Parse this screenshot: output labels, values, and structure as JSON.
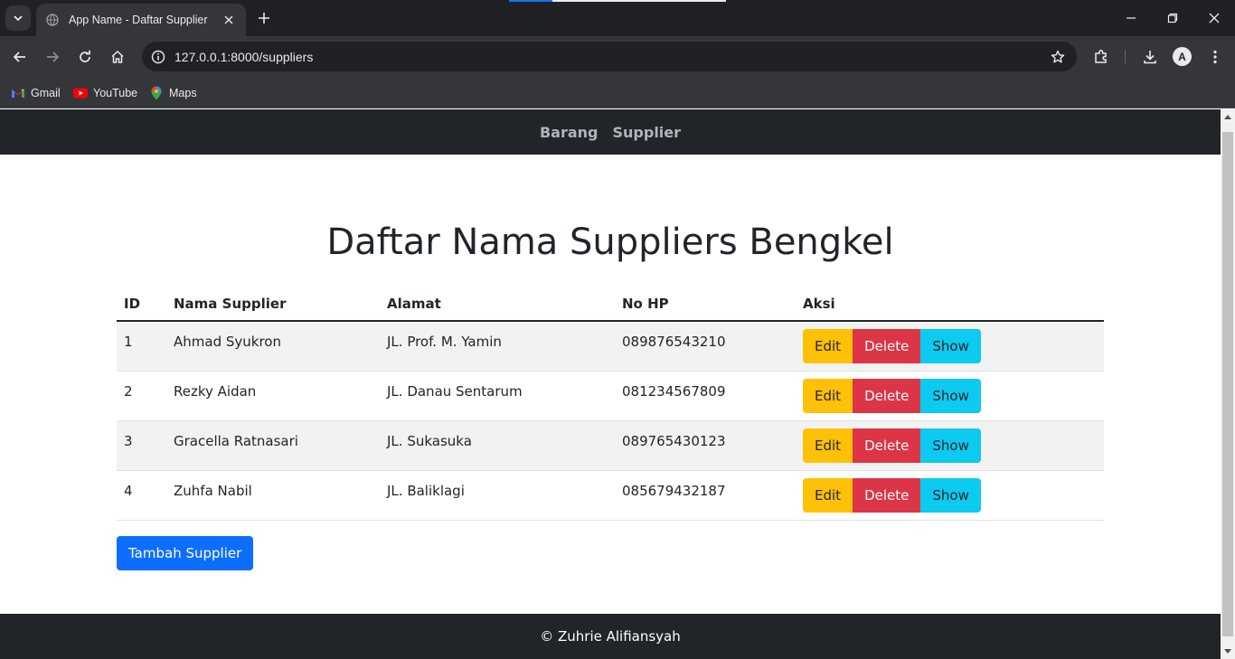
{
  "browser": {
    "tab_title": "App Name - Daftar Supplier",
    "url": "127.0.0.1:8000/suppliers",
    "bookmarks": [
      {
        "label": "Gmail",
        "icon": "gmail-icon"
      },
      {
        "label": "YouTube",
        "icon": "youtube-icon"
      },
      {
        "label": "Maps",
        "icon": "maps-icon"
      }
    ],
    "avatar_letter": "A"
  },
  "nav": {
    "links": [
      "Barang",
      "Supplier"
    ]
  },
  "page": {
    "title": "Daftar Nama Suppliers Bengkel"
  },
  "table": {
    "headers": [
      "ID",
      "Nama Supplier",
      "Alamat",
      "No HP",
      "Aksi"
    ],
    "rows": [
      {
        "id": "1",
        "nama": "Ahmad Syukron",
        "alamat": "JL. Prof. M. Yamin",
        "hp": "089876543210"
      },
      {
        "id": "2",
        "nama": "Rezky Aidan",
        "alamat": "JL. Danau Sentarum",
        "hp": "081234567809"
      },
      {
        "id": "3",
        "nama": "Gracella Ratnasari",
        "alamat": "JL. Sukasuka",
        "hp": "089765430123"
      },
      {
        "id": "4",
        "nama": "Zuhfa Nabil",
        "alamat": "JL. Baliklagi",
        "hp": "085679432187"
      }
    ],
    "actions": {
      "edit": "Edit",
      "delete": "Delete",
      "show": "Show"
    }
  },
  "add_button": "Tambah Supplier",
  "footer": "© Zuhrie Alifiansyah",
  "colors": {
    "navbar": "#212529",
    "edit": "#ffc107",
    "delete": "#dc3545",
    "show": "#0dcaf0",
    "primary": "#0d6efd"
  }
}
